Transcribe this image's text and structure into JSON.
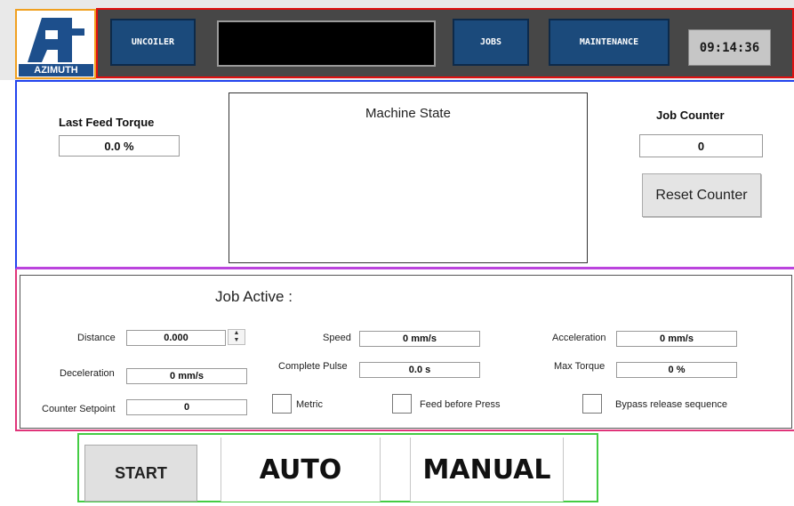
{
  "header": {
    "logo_text": "AZIMUTH",
    "nav": {
      "uncoiler": "UNCOILER",
      "jobs": "JOBS",
      "maintenance": "MAINTENANCE"
    },
    "clock": "09:14:36"
  },
  "status": {
    "last_feed_torque_label": "Last Feed Torque",
    "last_feed_torque_value": "0.0 %",
    "machine_state_label": "Machine State",
    "job_counter_label": "Job Counter",
    "job_counter_value": "0",
    "reset_counter_label": "Reset Counter"
  },
  "job": {
    "title": "Job Active :",
    "distance_label": "Distance",
    "distance_value": "0.000",
    "spinner_up": "▲",
    "spinner_down": "▼",
    "speed_label": "Speed",
    "speed_value": "0 mm/s",
    "acceleration_label": "Acceleration",
    "acceleration_value": "0 mm/s",
    "deceleration_label": "Deceleration",
    "deceleration_value": "0 mm/s",
    "complete_pulse_label": "Complete Pulse",
    "complete_pulse_value": "0.0 s",
    "max_torque_label": "Max Torque",
    "max_torque_value": "0 %",
    "counter_setpoint_label": "Counter Setpoint",
    "counter_setpoint_value": "0",
    "metric_label": "Metric",
    "feed_before_press_label": "Feed before Press",
    "bypass_label": "Bypass release sequence"
  },
  "controls": {
    "start": "START",
    "auto": "AUTO",
    "manual": "MANUAL"
  },
  "colors": {
    "nav_button": "#1b4a7b",
    "header_dark": "#474747",
    "logo_blue": "#1d4f8c"
  },
  "icons": {
    "logo": "azimuth-logo-icon"
  }
}
